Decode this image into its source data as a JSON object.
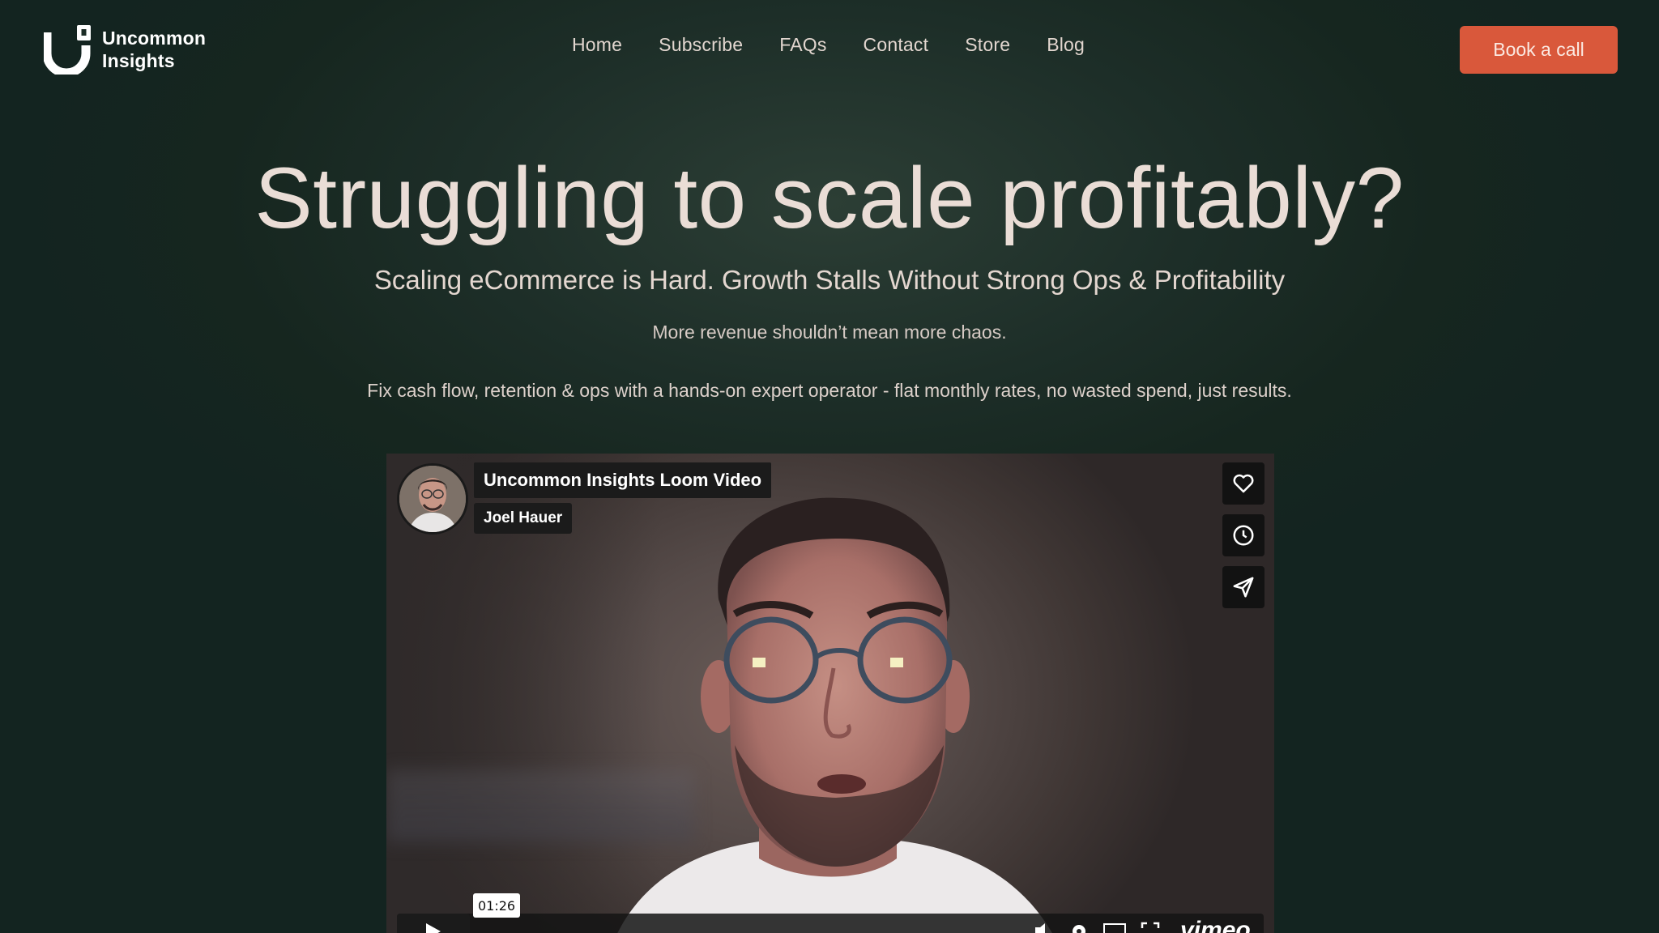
{
  "brand": {
    "line1": "Uncommon",
    "line2": "Insights"
  },
  "nav": [
    "Home",
    "Subscribe",
    "FAQs",
    "Contact",
    "Store",
    "Blog"
  ],
  "cta": "Book a call",
  "hero": {
    "title": "Struggling to scale profitably?",
    "subtitle": "Scaling eCommerce is Hard. Growth Stalls Without Strong Ops & Profitability",
    "line1": "More revenue shouldn’t mean more chaos.",
    "line2": "Fix cash flow, retention & ops with a hands-on expert operator - flat monthly rates, no wasted spend, just results."
  },
  "video": {
    "title": "Uncommon Insights Loom Video",
    "author": "Joel Hauer",
    "timestamp": "01:26",
    "provider": "vimeo",
    "icons": [
      "heart-icon",
      "clock-icon",
      "send-icon",
      "play-icon",
      "volume-icon",
      "settings-icon",
      "pip-icon",
      "fullscreen-icon"
    ]
  },
  "colors": {
    "background": "#16261f",
    "accent": "#d9583b",
    "text": "#eaddd6"
  }
}
